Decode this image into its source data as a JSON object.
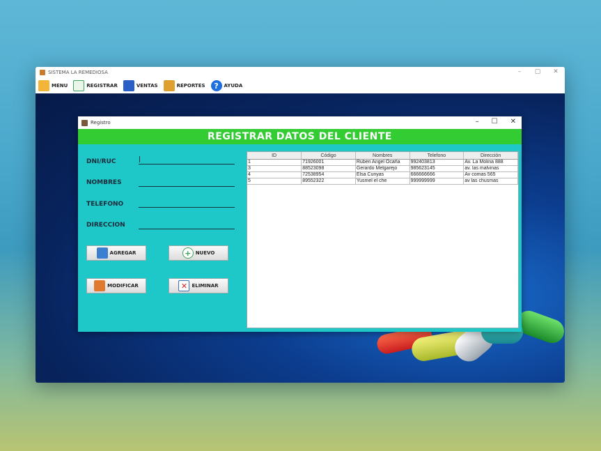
{
  "main_window": {
    "title": "SISTEMA LA REMEDIOSA",
    "controls": [
      "–",
      "▢",
      "✕"
    ]
  },
  "menubar": {
    "items": [
      {
        "label": "MENU",
        "icon": "folder-icon",
        "color": "#f2b53a"
      },
      {
        "label": "REGISTRAR",
        "icon": "register-icon",
        "color": "#3aa35a"
      },
      {
        "label": "VENTAS",
        "icon": "store-icon",
        "color": "#2a5fc8"
      },
      {
        "label": "REPORTES",
        "icon": "report-icon",
        "color": "#e0a030"
      },
      {
        "label": "AYUDA",
        "icon": "help-icon",
        "color": "#1e6fe0"
      }
    ]
  },
  "dialog": {
    "title": "Registro",
    "controls": [
      "–",
      "☐",
      "✕"
    ],
    "header": "REGISTRAR DATOS DEL CLIENTE",
    "fields": [
      {
        "label": "DNI/RUC",
        "value": ""
      },
      {
        "label": "NOMBRES",
        "value": ""
      },
      {
        "label": "TELEFONO",
        "value": ""
      },
      {
        "label": "DIRECCION",
        "value": ""
      }
    ],
    "buttons": {
      "agregar": "AGREGAR",
      "nuevo": "NUEVO",
      "modificar": "MODIFICAR",
      "eliminar": "ELIMINAR"
    }
  },
  "table": {
    "columns": [
      "ID",
      "Código",
      "Nombres",
      "Telefono",
      "Dirección"
    ],
    "rows": [
      [
        "1",
        "71926001",
        "Ruben Angel Ocaña",
        "992403813",
        "Av. La Molina 888"
      ],
      [
        "3",
        "88523098",
        "Gerardo Melgarejo",
        "985623145",
        "av. las malvinas"
      ],
      [
        "4",
        "72538954",
        "Elsa Cunyas",
        "666666666",
        "Av comas 565"
      ],
      [
        "5",
        "89552322",
        "Yusmel el che",
        "999999999",
        "av las chusmas"
      ]
    ]
  },
  "colors": {
    "dialog_bg": "#1ec8c8",
    "header_bg": "#33cc33",
    "desktop_bg": "#0c3d8f"
  }
}
